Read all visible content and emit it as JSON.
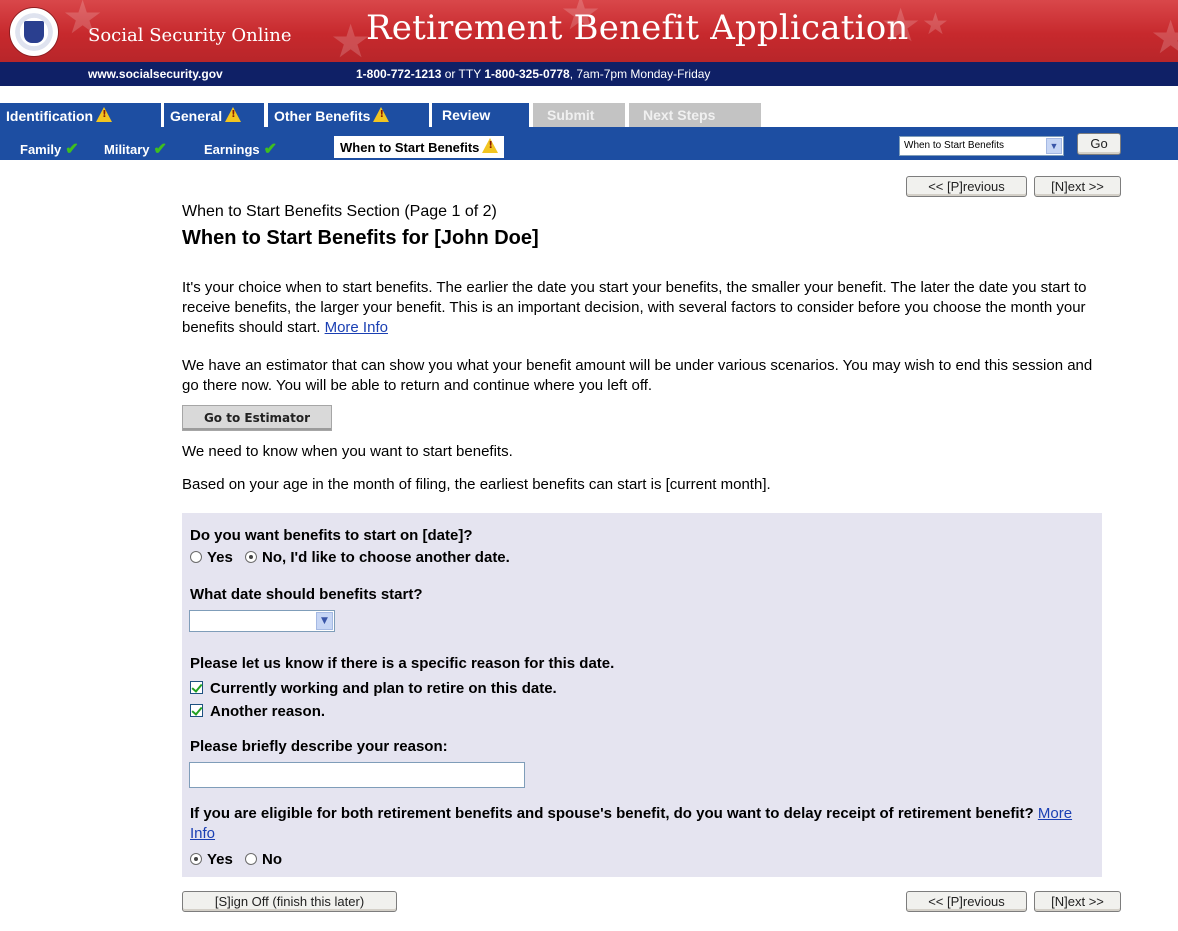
{
  "banner": {
    "site_name": "Social Security Online",
    "app_title": "Retirement Benefit Application"
  },
  "contact": {
    "url": "www.socialsecurity.gov",
    "phone_main": "1-800-772-1213",
    "or_tty": " or TTY ",
    "phone_tty": "1-800-325-0778",
    "hours": ", 7am-7pm Monday-Friday"
  },
  "tabs": [
    {
      "label": "Identification",
      "warning": true,
      "state": "normal"
    },
    {
      "label": "General",
      "warning": true,
      "state": "active"
    },
    {
      "label": "Other Benefits",
      "warning": true,
      "state": "normal"
    },
    {
      "label": "Review",
      "warning": false,
      "state": "normal"
    },
    {
      "label": "Submit",
      "warning": false,
      "state": "disabled"
    },
    {
      "label": "Next Steps",
      "warning": false,
      "state": "disabled"
    }
  ],
  "subnav": {
    "items": [
      {
        "label": "Family",
        "status": "complete"
      },
      {
        "label": "Military",
        "status": "complete"
      },
      {
        "label": "Earnings",
        "status": "complete"
      },
      {
        "label": "When to Start Benefits",
        "status": "warning"
      }
    ],
    "jump_select_value": "When to Start Benefits",
    "go_label": "Go"
  },
  "nav": {
    "previous_label": "<< [P]revious",
    "next_label": "[N]ext >>",
    "signoff_label": "[S]ign Off (finish this later)"
  },
  "page": {
    "section_subtitle": "When to Start Benefits Section (Page 1 of 2)",
    "title": "When to Start Benefits for [John Doe]",
    "intro": "It's your choice when to start benefits. The earlier the date you start your benefits, the smaller your benefit. The later the date you start to receive benefits, the larger your benefit. This is an important decision, with several factors to consider before you choose the month your benefits should start.",
    "more_info_label": "More Info",
    "estimator_text": "We have an estimator that can show you what your benefit amount will be under various scenarios. You may wish to end this session and go there now. You will be able to return and continue where you left off.",
    "estimator_button": "Go to Estimator",
    "need_to_know": "We need to know when you want to start benefits.",
    "earliest": "Based on your age in the month of filing, the earliest benefits can start is [current month]."
  },
  "form": {
    "q1": "Do you want benefits to start on [date]?",
    "q1_yes": "Yes",
    "q1_no": "No, I'd like to choose another date.",
    "q1_selected": "no",
    "q2": "What date should benefits start?",
    "q2_value": "",
    "q3": "Please let us know if there is a specific reason for this date.",
    "q3_opt1": "Currently working and plan to retire on this date.",
    "q3_opt1_checked": true,
    "q3_opt2": "Another reason.",
    "q3_opt2_checked": true,
    "q4": "Please briefly describe your reason:",
    "q4_value": "",
    "q5": "If you are eligible for both retirement benefits and spouse's benefit, do you want to delay receipt of retirement benefit?",
    "q5_more_info": "More Info",
    "q5_yes": "Yes",
    "q5_no": "No",
    "q5_selected": "yes"
  },
  "colors": {
    "banner_red": "#c7292d",
    "contact_navy": "#0f2066",
    "tab_blue": "#1d4ea2",
    "panel_lavender": "#e5e4f0",
    "warning_yellow": "#f2c521",
    "check_green": "#3fbf1f"
  }
}
